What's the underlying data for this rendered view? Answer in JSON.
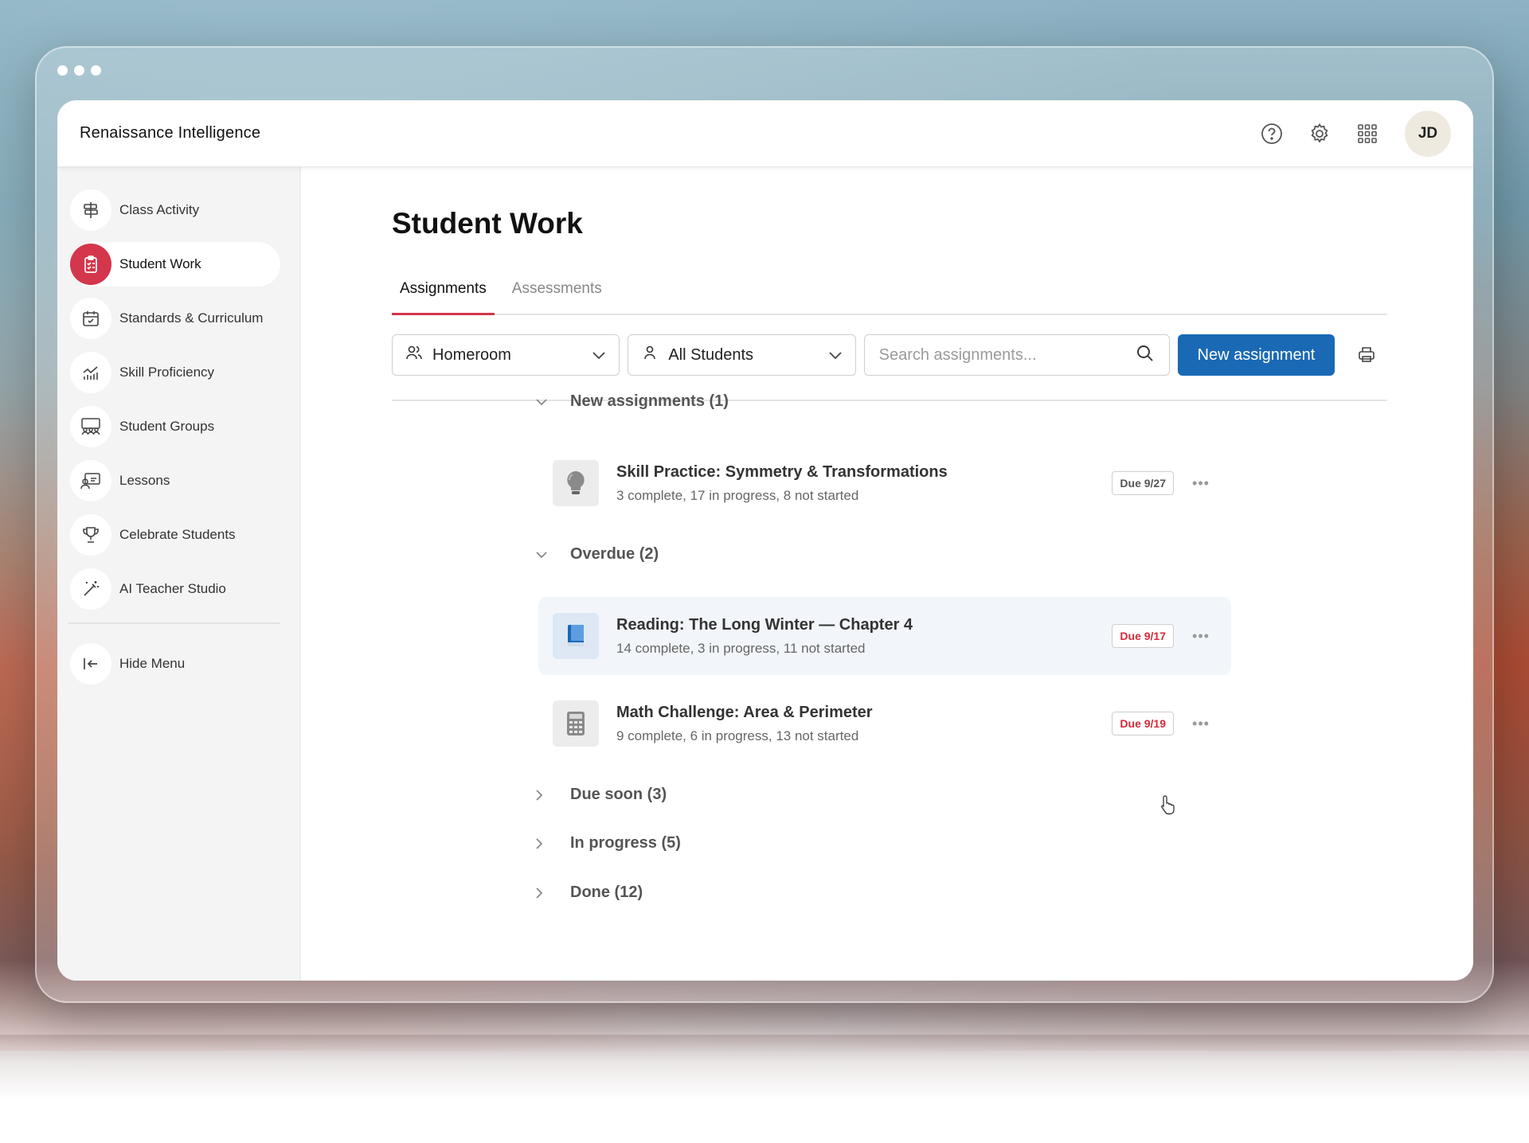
{
  "window": {
    "controls": [
      "dot",
      "dot",
      "dot"
    ]
  },
  "header": {
    "brand": "Renaissance Intelligence",
    "icons": [
      "help-icon",
      "settings-gear-icon",
      "apps-grid-icon"
    ],
    "avatar_initials": "JD"
  },
  "sidebar": {
    "items": [
      {
        "label": "Class Activity",
        "icon": "signpost-icon",
        "active": false
      },
      {
        "label": "Student Work",
        "icon": "clipboard-icon",
        "active": true
      },
      {
        "label": "Standards & Curriculum",
        "icon": "calendar-check-icon",
        "active": false
      },
      {
        "label": "Skill Proficiency",
        "icon": "chart-line-icon",
        "active": false
      },
      {
        "label": "Student Groups",
        "icon": "group-icon",
        "active": false
      },
      {
        "label": "Lessons",
        "icon": "presenter-icon",
        "active": false
      },
      {
        "label": "Celebrate Students",
        "icon": "trophy-icon",
        "active": false
      },
      {
        "label": "AI Teacher Studio",
        "icon": "magic-wand-icon",
        "active": false
      }
    ],
    "hide_menu": "Hide Menu"
  },
  "main": {
    "title": "Student Work",
    "tabs": [
      {
        "label": "Assignments",
        "active": true
      },
      {
        "label": "Assessments",
        "active": false
      }
    ],
    "filters": {
      "class_select": "Homeroom",
      "student_select": "All Students",
      "search_placeholder": "Search assignments...",
      "search_value": "",
      "new_button": "New assignment"
    },
    "sections": {
      "new": "New assignments (1)",
      "overdue": "Overdue (2)",
      "due_soon": "Due soon (3)",
      "in_progress": "In progress (5)",
      "done": "Done (12)"
    },
    "assignments": [
      {
        "title": "Skill Practice: Symmetry & Transformations",
        "meta": "3 complete, 17 in progress, 8 not started",
        "due": "Due 9/27",
        "overdue": false,
        "icon": "lightbulb-icon"
      },
      {
        "title": "Reading: The Long Winter — Chapter 4",
        "meta": "14 complete, 3 in progress, 11 not started",
        "due": "Due 9/17",
        "overdue": true,
        "icon": "book-icon"
      },
      {
        "title": "Math Challenge: Area & Perimeter",
        "meta": "9 complete, 6 in progress, 13 not started",
        "due": "Due 9/19",
        "overdue": true,
        "icon": "calculator-icon"
      }
    ],
    "more_label": "•••"
  },
  "colors": {
    "accent_red": "#d4364b",
    "primary_blue": "#1a69b5",
    "overdue_red": "#d42a3a"
  }
}
